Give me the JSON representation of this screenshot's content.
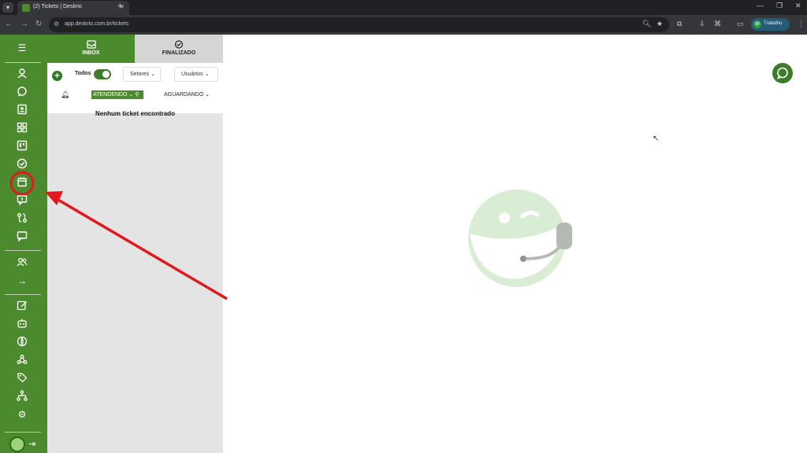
{
  "browser": {
    "tab_title": "(2) Tickets | Deskrio",
    "url": "app.deskrio.com.br/tickets",
    "profile_label": "Trabalho",
    "profile_initial": "W"
  },
  "ticket_panel": {
    "tabs": [
      {
        "label": "INBOX",
        "active": true
      },
      {
        "label": "FINALIZADO",
        "active": false
      }
    ],
    "todos_label": "Todos",
    "todos_toggle_on": true,
    "setores_label": "Setores",
    "usuarios_label": "Usuários",
    "status_active": "ATENDENDO",
    "status_other": "AGUARDANDO",
    "empty_message": "Nenhum ticket encontrado"
  },
  "sidebar": {
    "icons": [
      "menu-icon",
      "user-icon",
      "chat-icon",
      "contacts-icon",
      "dashboard-icon",
      "kanban-icon",
      "check-circle-icon",
      "calendar-icon",
      "quick-reply-icon",
      "flow-icon",
      "feedback-icon",
      "users-icon",
      "arrow-right-icon",
      "edit-icon",
      "bot-icon",
      "integration-icon",
      "webhook-icon",
      "tags-icon",
      "hierarchy-icon",
      "settings-icon",
      "logout-icon"
    ]
  },
  "colors": {
    "brand_green": "#4b8b2e",
    "annotation_red": "#e0191f"
  }
}
